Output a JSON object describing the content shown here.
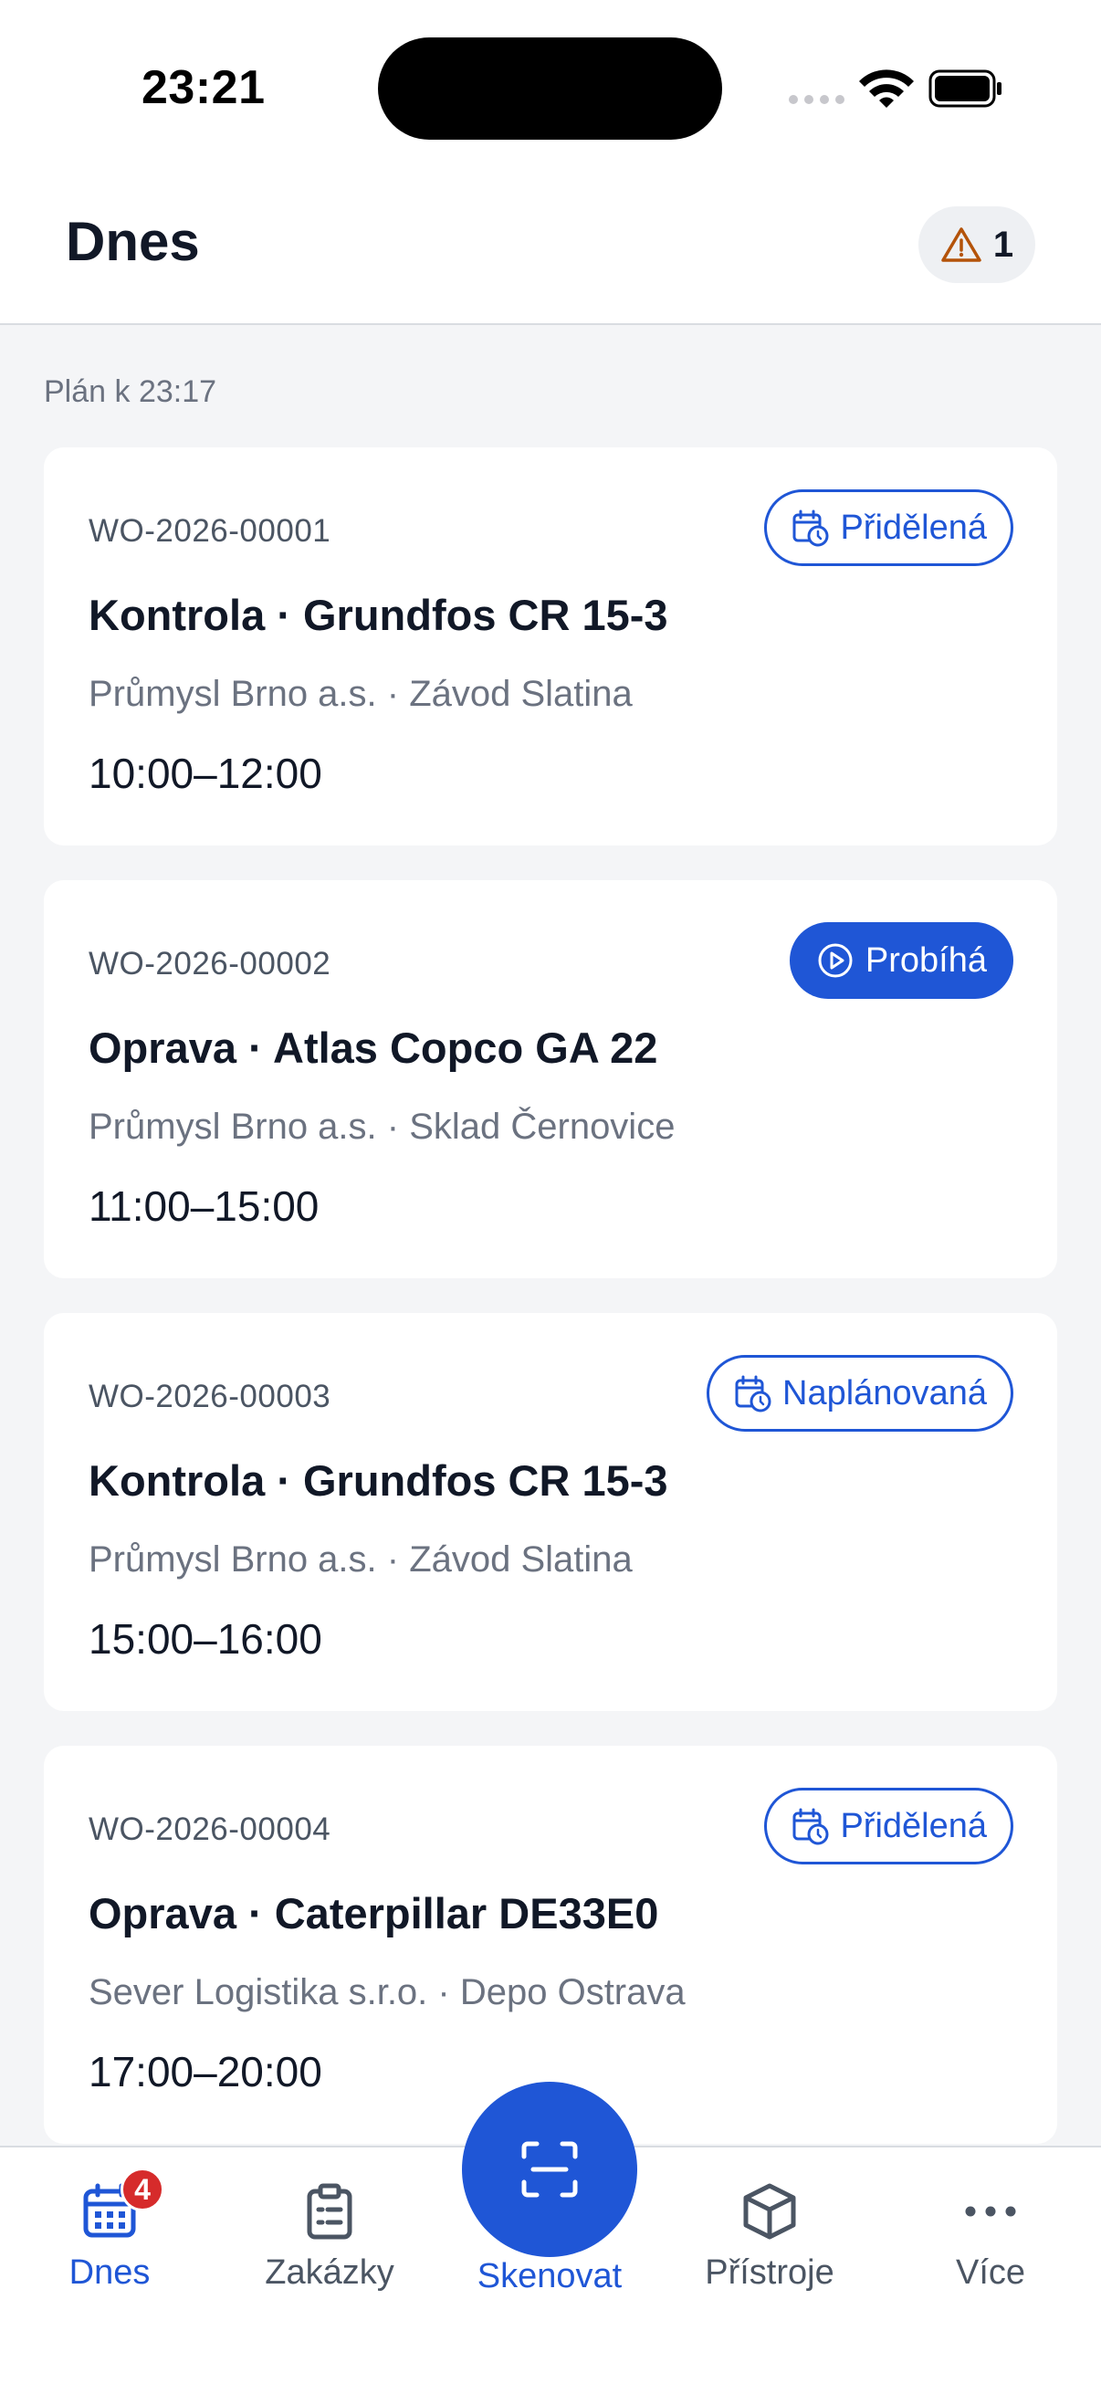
{
  "status_bar": {
    "time": "23:21"
  },
  "header": {
    "title": "Dnes",
    "alert_count": "1"
  },
  "plan_label": "Plán k 23:17",
  "work_orders": [
    {
      "id": "WO-2026-00001",
      "title": "Kontrola · Grundfos CR 15-3",
      "subtitle": "Průmysl Brno a.s. · Závod Slatina",
      "time": "10:00–12:00",
      "status": "Přidělená",
      "status_style": "outline",
      "status_icon": "calendar-clock-icon"
    },
    {
      "id": "WO-2026-00002",
      "title": "Oprava · Atlas Copco GA 22",
      "subtitle": "Průmysl Brno a.s. · Sklad Černovice",
      "time": "11:00–15:00",
      "status": "Probíhá",
      "status_style": "filled",
      "status_icon": "play-circle-icon"
    },
    {
      "id": "WO-2026-00003",
      "title": "Kontrola · Grundfos CR 15-3",
      "subtitle": "Průmysl Brno a.s. · Závod Slatina",
      "time": "15:00–16:00",
      "status": "Naplánovaná",
      "status_style": "outline",
      "status_icon": "calendar-clock-icon"
    },
    {
      "id": "WO-2026-00004",
      "title": "Oprava · Caterpillar DE33E0",
      "subtitle": "Sever Logistika s.r.o. · Depo Ostrava",
      "time": "17:00–20:00",
      "status": "Přidělená",
      "status_style": "outline",
      "status_icon": "calendar-clock-icon"
    }
  ],
  "tabbar": {
    "items": [
      {
        "label": "Dnes",
        "icon": "calendar-icon",
        "badge": "4",
        "active": true
      },
      {
        "label": "Zakázky",
        "icon": "clipboard-icon"
      },
      {
        "label": "Skenovat",
        "icon": "scan-icon"
      },
      {
        "label": "Přístroje",
        "icon": "box-icon"
      },
      {
        "label": "Více",
        "icon": "more-icon"
      }
    ]
  },
  "colors": {
    "accent": "#1f56d6",
    "badge_red": "#d62b2b",
    "warning": "#b45309"
  }
}
